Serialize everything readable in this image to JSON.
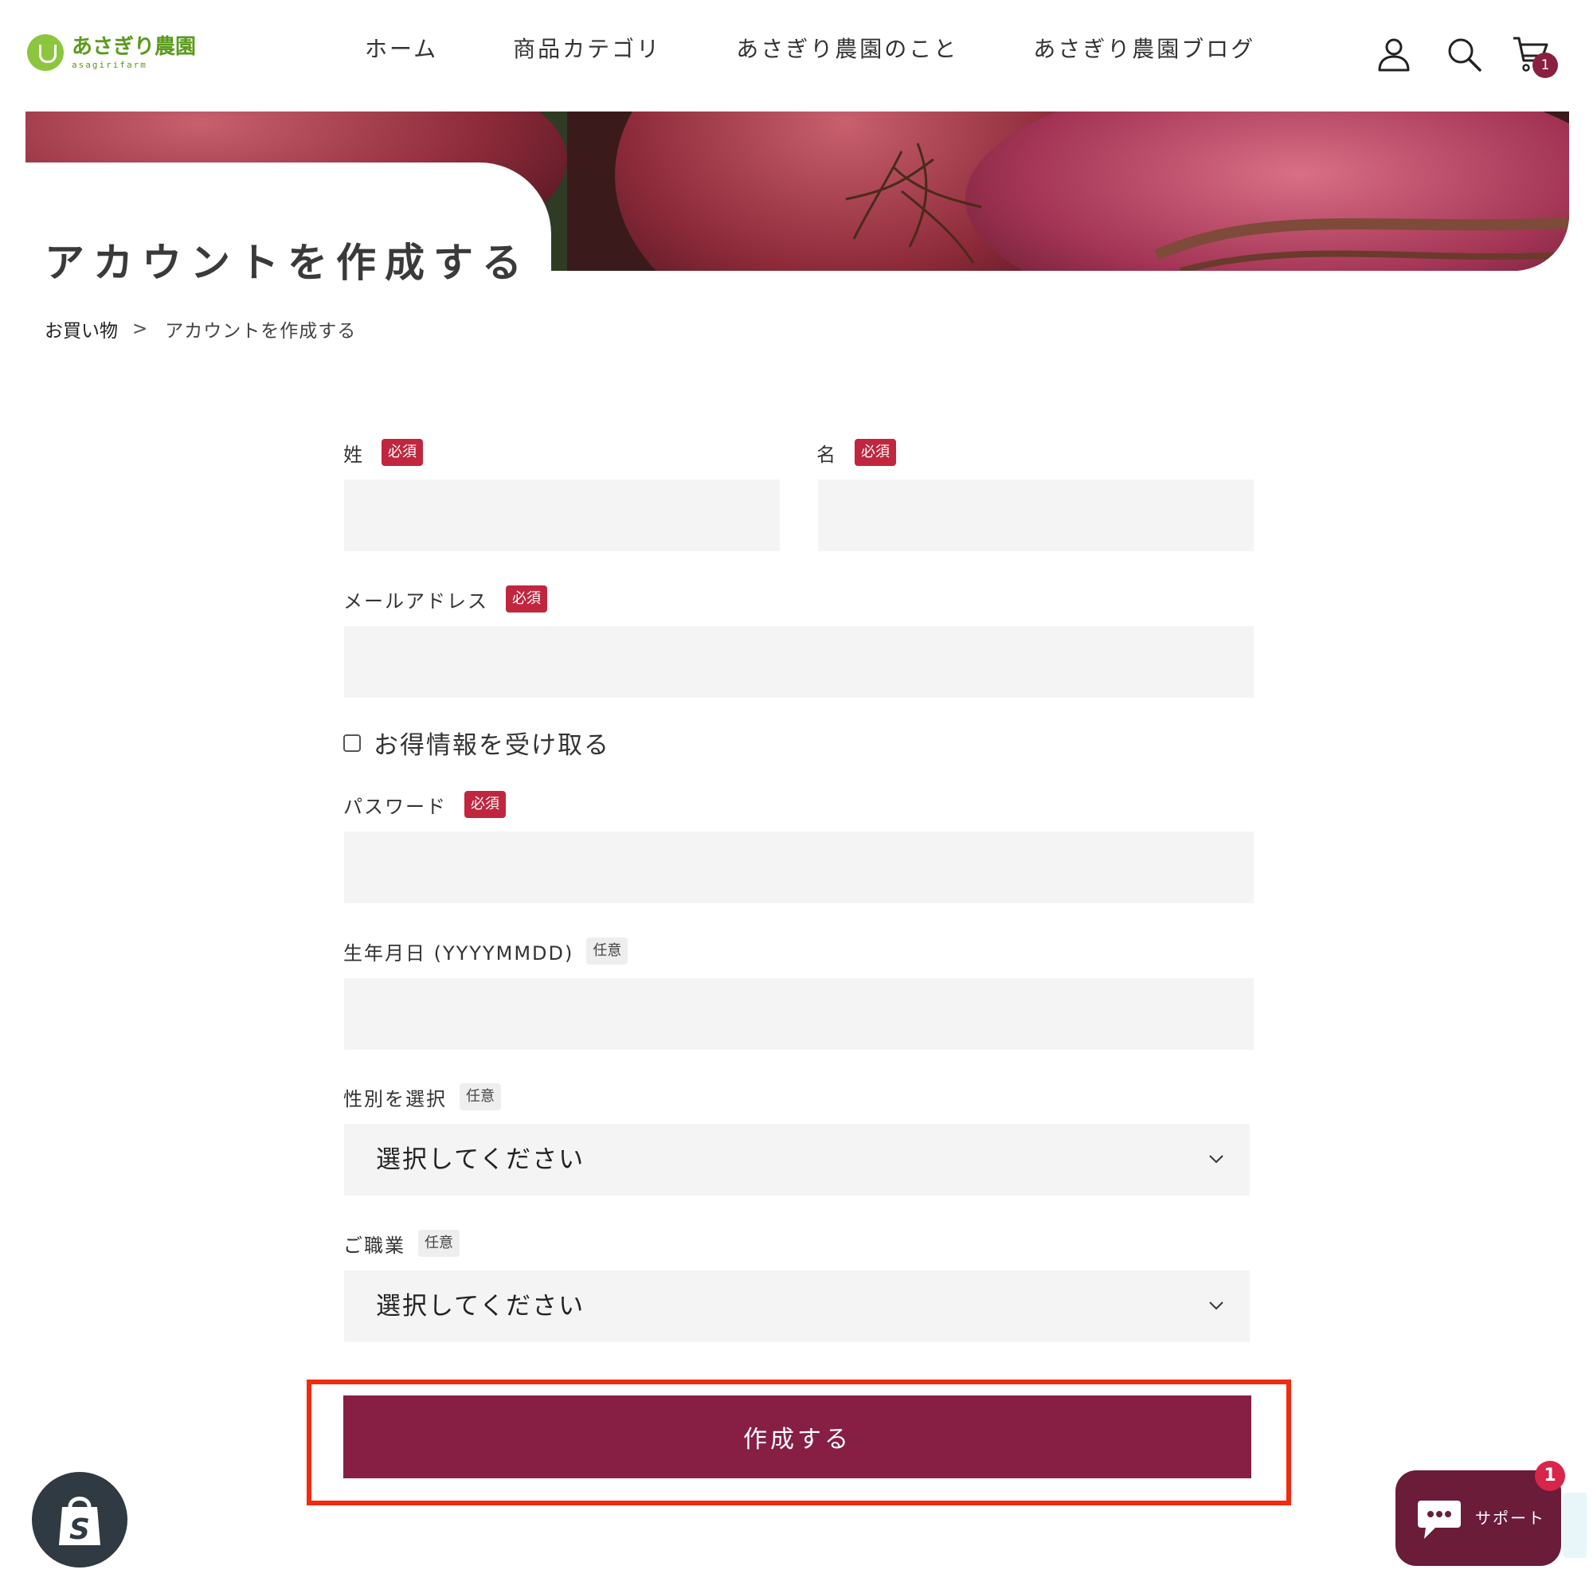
{
  "header": {
    "logo": {
      "text_jp": "あさぎり農園",
      "text_en": "asagirifarm",
      "color": "#5a9a1c"
    },
    "nav": [
      {
        "label": "ホーム"
      },
      {
        "label": "商品カテゴリ"
      },
      {
        "label": "あさぎり農園のこと"
      },
      {
        "label": "あさぎり農園ブログ"
      }
    ],
    "icons": [
      "account-icon",
      "search-icon",
      "cart-icon"
    ],
    "cart_count": "1"
  },
  "page": {
    "title": "アカウントを作成する",
    "breadcrumb": {
      "home": "お買い物",
      "separator": ">",
      "current": "アカウントを作成する"
    }
  },
  "form": {
    "last_name": {
      "label": "姓",
      "badge": "必須",
      "value": ""
    },
    "first_name": {
      "label": "名",
      "badge": "必須",
      "value": ""
    },
    "email": {
      "label": "メールアドレス",
      "badge": "必須",
      "value": ""
    },
    "newsletter": {
      "label": "お得情報を受け取る",
      "checked": false
    },
    "password": {
      "label": "パスワード",
      "badge": "必須",
      "value": ""
    },
    "birthday": {
      "label": "生年月日 (YYYYMMDD)",
      "badge": "任意",
      "value": ""
    },
    "gender": {
      "label": "性別を選択",
      "badge": "任意",
      "selected": "選択してください"
    },
    "occupation": {
      "label": "ご職業",
      "badge": "任意",
      "selected": "選択してください"
    },
    "submit_label": "作成する"
  },
  "floating": {
    "support_label": "サポート",
    "support_badge": "1"
  },
  "colors": {
    "accent": "#861f43",
    "required_badge": "#c1263f",
    "highlight": "#f12a10",
    "input_bg": "#f4f4f4"
  }
}
